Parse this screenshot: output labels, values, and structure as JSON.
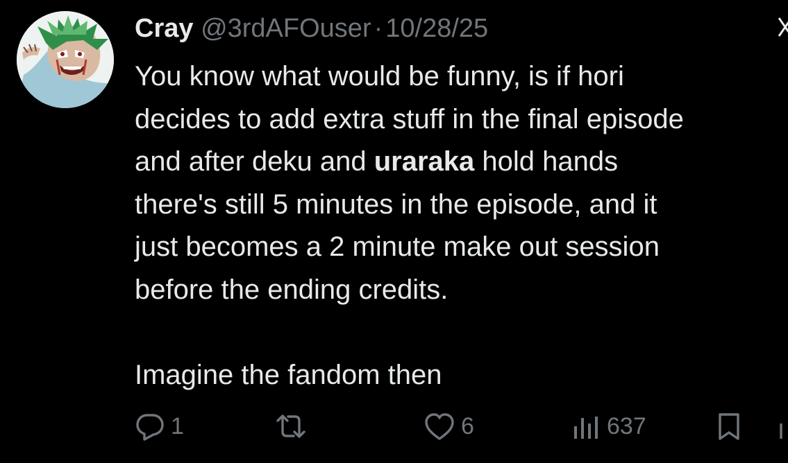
{
  "tweet": {
    "display_name": "Cray",
    "handle": "@3rdAFOuser",
    "separator": "·",
    "date": "10/28/25",
    "text_lines": [
      "You know what would be funny, is if hori",
      "decides to add extra stuff in the final episode",
      "and after deku and ",
      "uraraka",
      " hold hands",
      "there's still 5 minutes in the episode, and it",
      "just becomes a 2 minute make out session",
      "before the ending credits.",
      "Imagine the fandom then"
    ]
  },
  "actions": {
    "reply_count": "1",
    "retweet_count": "",
    "like_count": "6",
    "views_count": "637"
  },
  "icons": {
    "more": "more-icon",
    "reply": "reply-icon",
    "retweet": "retweet-icon",
    "like": "heart-icon",
    "views": "views-icon",
    "bookmark": "bookmark-icon",
    "share": "share-icon"
  },
  "colors": {
    "background": "#000000",
    "primary_text": "#e7e9ea",
    "secondary_text": "#71767b"
  }
}
